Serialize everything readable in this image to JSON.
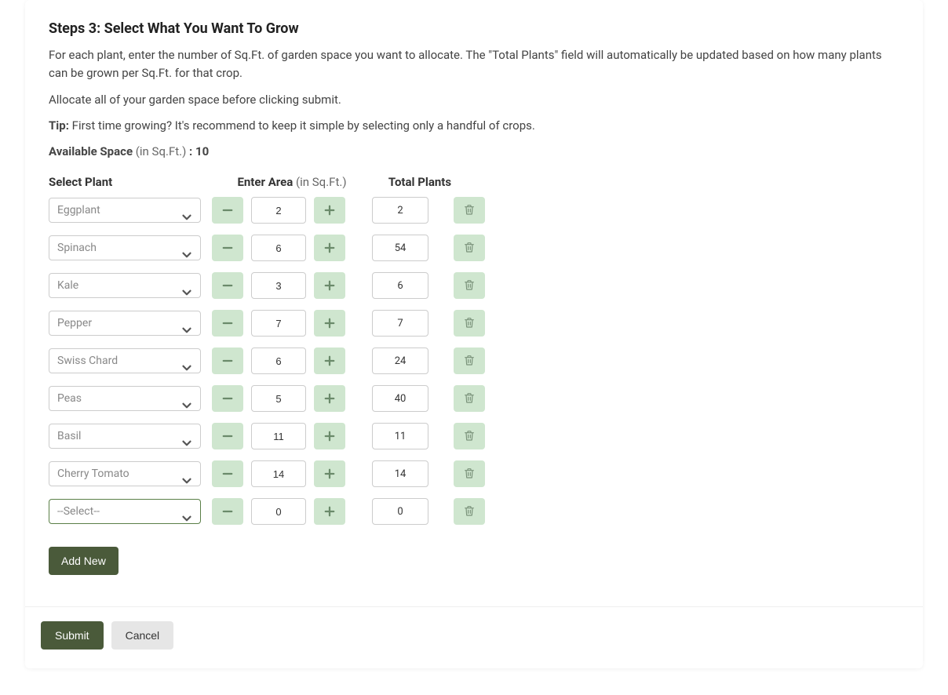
{
  "header": {
    "title": "Steps 3: Select What You Want To Grow"
  },
  "intro": {
    "p1": "For each plant, enter the number of Sq.Ft. of garden space you want to allocate. The \"Total Plants\" field will automatically be updated based on how many plants can be grown per Sq.Ft. for that crop.",
    "p2": "Allocate all of your garden space before clicking submit.",
    "tip_label": "Tip:",
    "tip_text": " First time growing? It's recommend to keep it simple by selecting only a handful of crops.",
    "avail_label": "Available Space",
    "avail_unit": " (in Sq.Ft.) ",
    "avail_sep": ": ",
    "avail_value": "10"
  },
  "columns": {
    "plant": "Select Plant",
    "area_label": "Enter Area",
    "area_unit": " (in Sq.Ft.)",
    "total": "Total Plants"
  },
  "rows": [
    {
      "plant": "Eggplant",
      "area": "2",
      "total": "2",
      "active": false
    },
    {
      "plant": "Spinach",
      "area": "6",
      "total": "54",
      "active": false
    },
    {
      "plant": "Kale",
      "area": "3",
      "total": "6",
      "active": false
    },
    {
      "plant": "Pepper",
      "area": "7",
      "total": "7",
      "active": false
    },
    {
      "plant": "Swiss Chard",
      "area": "6",
      "total": "24",
      "active": false
    },
    {
      "plant": "Peas",
      "area": "5",
      "total": "40",
      "active": false
    },
    {
      "plant": "Basil",
      "area": "11",
      "total": "11",
      "active": false
    },
    {
      "plant": "Cherry Tomato",
      "area": "14",
      "total": "14",
      "active": false
    },
    {
      "plant": "--Select--",
      "area": "0",
      "total": "0",
      "active": true
    }
  ],
  "buttons": {
    "add": "Add New",
    "submit": "Submit",
    "cancel": "Cancel"
  }
}
